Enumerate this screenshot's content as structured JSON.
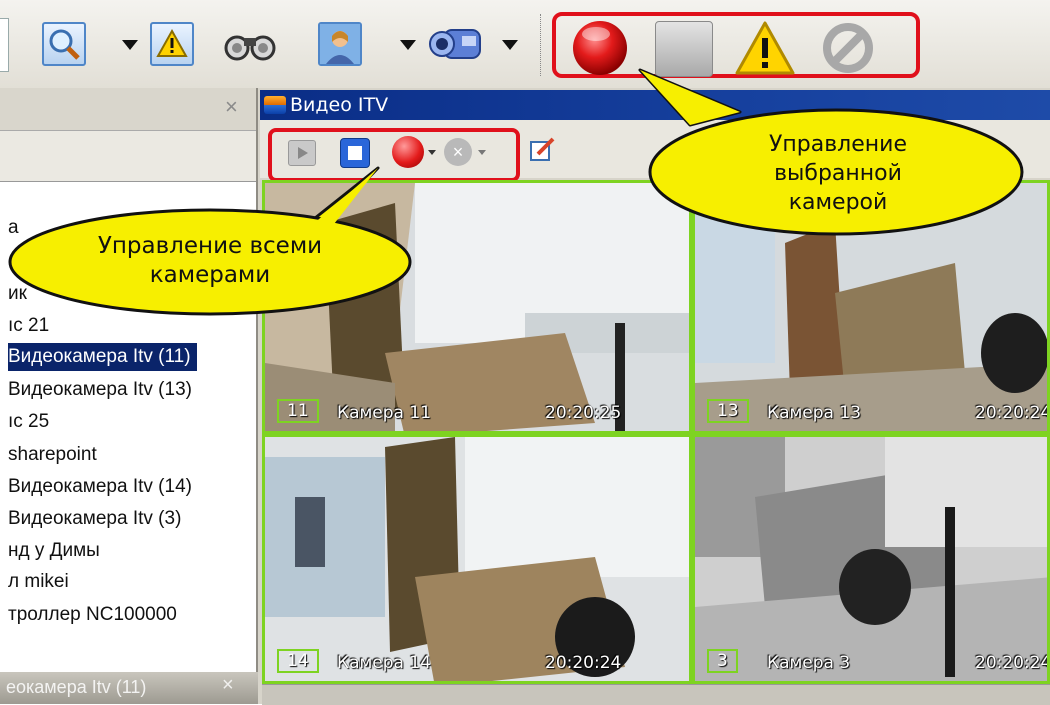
{
  "video_window": {
    "title": "Видео ITV"
  },
  "tree_items": [
    {
      "label": "а"
    },
    {
      "label": "ик"
    },
    {
      "label": "ıс 21"
    },
    {
      "label": "Видеокамера Itv (11)",
      "selected": true
    },
    {
      "label": "Видеокамера Itv (13)"
    },
    {
      "label": "ıс 25"
    },
    {
      "label": "sharepoint"
    },
    {
      "label": "Видеокамера Itv (14)"
    },
    {
      "label": "Видеокамера Itv (3)"
    },
    {
      "label": "нд у Димы"
    },
    {
      "label": "л mikei"
    },
    {
      "label": "троллер NC100000"
    }
  ],
  "left_panel_footer": {
    "label": "еокамера Itv (11)"
  },
  "cameras": [
    {
      "number": "11",
      "name": "Камера 11",
      "time": "20:20:25",
      "grayscale": false
    },
    {
      "number": "13",
      "name": "Камера 13",
      "time": "20:20:24",
      "grayscale": false
    },
    {
      "number": "14",
      "name": "Камера 14",
      "time": "20:20:24",
      "grayscale": false
    },
    {
      "number": "3",
      "name": "Камера 3",
      "time": "20:20:24",
      "grayscale": true
    }
  ],
  "callouts": {
    "all_cameras": {
      "line1": "Управление всеми",
      "line2": "камерами"
    },
    "selected_camera": {
      "line1": "Управление",
      "line2": "выбранной",
      "line3": "камерой"
    }
  },
  "icons": [
    "search-icon",
    "alarm-icon",
    "binoculars-icon",
    "user-icon",
    "camera-icon",
    "record-icon",
    "stop-icon",
    "warning-icon",
    "disable-icon",
    "play-icon",
    "edit-icon"
  ],
  "colors": {
    "highlight": "#e0101b",
    "tile_border": "#7ed321",
    "callout_fill": "#f7ef00",
    "selection": "#0a246a"
  }
}
